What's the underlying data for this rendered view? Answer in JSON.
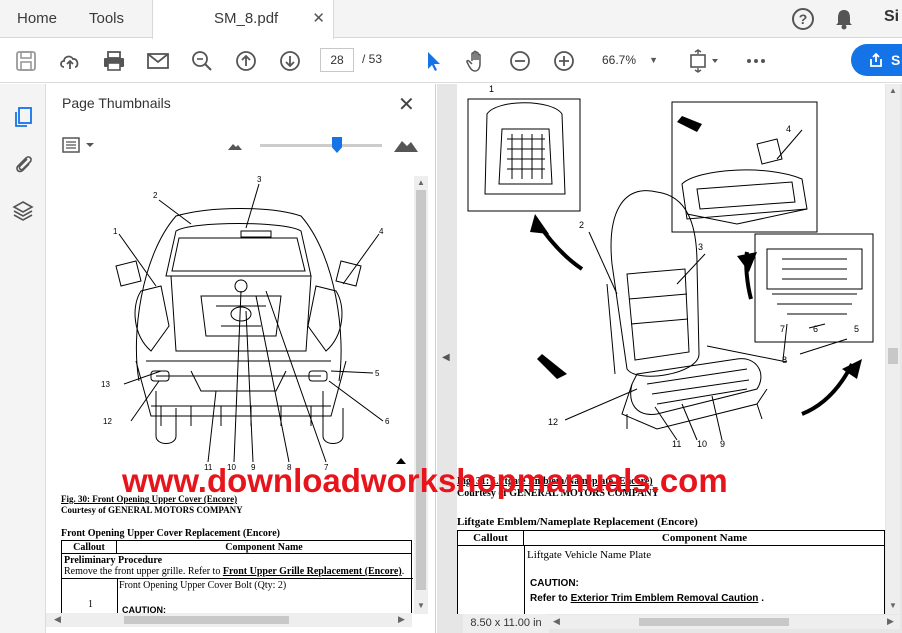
{
  "tabs": {
    "home": "Home",
    "tools": "Tools",
    "document": "SM_8.pdf",
    "signin": "Si"
  },
  "toolbar": {
    "current_page": "28",
    "total_pages": "/ 53",
    "zoom": "66.7%",
    "share_label": "S"
  },
  "thumb_panel": {
    "title": "Page Thumbnails"
  },
  "left_page": {
    "callouts": [
      "1",
      "2",
      "3",
      "4",
      "5",
      "6",
      "7",
      "8",
      "9",
      "10",
      "11",
      "12",
      "13"
    ],
    "fig_caption": "Fig. 30: Front Opening Upper Cover (Encore)",
    "courtesy": "Courtesy of GENERAL MOTORS COMPANY",
    "section_title": "Front Opening Upper Cover Replacement (Encore)",
    "table": {
      "headers": [
        "Callout",
        "Component Name"
      ],
      "prelim_title": "Preliminary Procedure",
      "prelim_text": "Remove the front upper grille. Refer to",
      "prelim_link": "Front Upper Grille Replacement (Encore)",
      "row_callout": "1",
      "row_item": "Front Opening Upper Cover Bolt (Qty: 2)",
      "row_caution": "CAUTION:"
    }
  },
  "right_page": {
    "callouts": [
      "1",
      "2",
      "3",
      "4",
      "5",
      "6",
      "7",
      "8",
      "9",
      "10",
      "11",
      "12"
    ],
    "fig_caption": "Fig. 31: Liftgate Emblem/Nameplate (Encore)",
    "courtesy": "Courtesy of GENERAL MOTORS COMPANY",
    "section_title": "Liftgate Emblem/Nameplate Replacement (Encore)",
    "table": {
      "headers": [
        "Callout",
        "Component Name"
      ],
      "item": "Liftgate Vehicle Name Plate",
      "caution": "CAUTION:",
      "refer": "Refer to",
      "link": "Exterior Trim Emblem Removal Caution",
      "period": "."
    }
  },
  "status": {
    "page_size": "8.50 x 11.00 in"
  },
  "watermark": "www.downloadworkshopmanuals.com"
}
